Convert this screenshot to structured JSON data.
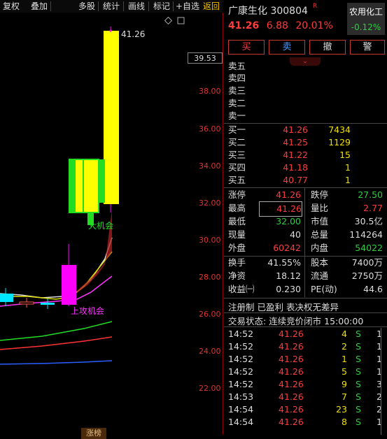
{
  "toolbar": {
    "items": [
      "复权",
      "叠加",
      "多股",
      "统计",
      "画线",
      "标记",
      "+自选",
      "返回"
    ]
  },
  "chart": {
    "y_ticks": [
      "38.00",
      "36.00",
      "34.00",
      "32.00",
      "30.00",
      "28.00",
      "26.00",
      "24.00",
      "22.00"
    ],
    "current_price_marker": "39.53",
    "high_label": "41.26",
    "annotation_big": "大机会",
    "annotation_attack": "上攻机会",
    "bottom_tag": "涨榜"
  },
  "header": {
    "stock_name": "广康生化 300804",
    "r_mark": "R",
    "price": "41.26",
    "change": "6.88",
    "change_pct": "20.01%",
    "sector_name": "农用化工",
    "sector_pct": "-0.12%"
  },
  "trade_buttons": {
    "buy": "买",
    "sell": "卖",
    "cancel": "撤",
    "alert": "警"
  },
  "order_book": {
    "asks": [
      {
        "label": "卖五",
        "price": "",
        "vol": ""
      },
      {
        "label": "卖四",
        "price": "",
        "vol": ""
      },
      {
        "label": "卖三",
        "price": "",
        "vol": ""
      },
      {
        "label": "卖二",
        "price": "",
        "vol": ""
      },
      {
        "label": "卖一",
        "price": "",
        "vol": ""
      }
    ],
    "bids": [
      {
        "label": "买一",
        "price": "41.26",
        "vol": "7434"
      },
      {
        "label": "买二",
        "price": "41.25",
        "vol": "1129"
      },
      {
        "label": "买三",
        "price": "41.22",
        "vol": "15"
      },
      {
        "label": "买四",
        "price": "41.18",
        "vol": "1"
      },
      {
        "label": "买五",
        "price": "40.77",
        "vol": "1"
      }
    ]
  },
  "stats": {
    "limit_up_label": "涨停",
    "limit_up": "41.26",
    "limit_down_label": "跌停",
    "limit_down": "27.50",
    "high_label": "最高",
    "high": "41.26",
    "vol_ratio_label": "量比",
    "vol_ratio": "2.77",
    "low_label": "最低",
    "low": "32.00",
    "mkt_cap_label": "市值",
    "mkt_cap": "30.5亿",
    "cur_vol_label": "现量",
    "cur_vol": "40",
    "total_vol_label": "总量",
    "total_vol": "114264",
    "outer_label": "外盘",
    "outer": "60242",
    "inner_label": "内盘",
    "inner": "54022",
    "turnover_label": "换手",
    "turnover": "41.55%",
    "equity_label": "股本",
    "equity": "7400万",
    "nav_label": "净资",
    "nav": "18.12",
    "float_label": "流通",
    "float": "2750万",
    "eps_label": "收益㈠",
    "eps": "0.230",
    "pe_label": "PE(动)",
    "pe": "44.6"
  },
  "info_line": "注册制 已盈利 表决权无差异",
  "trade_status": "交易状态: 连续竞价闭市 15:00:00",
  "ticks": [
    {
      "time": "14:52",
      "price": "41.26",
      "vol": "4",
      "dir": "S",
      "num": "1"
    },
    {
      "time": "14:52",
      "price": "41.26",
      "vol": "2",
      "dir": "S",
      "num": "1"
    },
    {
      "time": "14:52",
      "price": "41.26",
      "vol": "1",
      "dir": "S",
      "num": "1"
    },
    {
      "time": "14:52",
      "price": "41.26",
      "vol": "5",
      "dir": "S",
      "num": "1"
    },
    {
      "time": "14:52",
      "price": "41.26",
      "vol": "9",
      "dir": "S",
      "num": "3"
    },
    {
      "time": "14:53",
      "price": "41.26",
      "vol": "7",
      "dir": "S",
      "num": "2"
    },
    {
      "time": "14:54",
      "price": "41.26",
      "vol": "23",
      "dir": "S",
      "num": "2"
    },
    {
      "time": "14:54",
      "price": "41.26",
      "vol": "8",
      "dir": "S",
      "num": "1"
    }
  ],
  "colors": {
    "up": "#ff3b3b",
    "down": "#2ecc40",
    "volume": "#f0e000",
    "candle_up_yellow": "#ffff00",
    "candle_magenta": "#ff00ff"
  }
}
